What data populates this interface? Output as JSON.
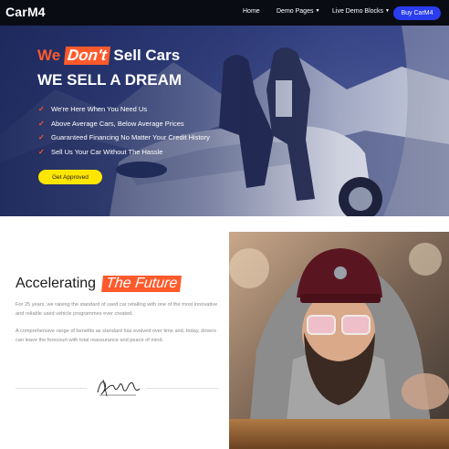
{
  "nav": {
    "logo": "CarM4",
    "links": [
      {
        "label": "Home"
      },
      {
        "label": "Demo Pages"
      },
      {
        "label": "Live Demo Blocks"
      }
    ],
    "cta": "Buy CarM4"
  },
  "hero": {
    "title_line1_prefix": "We",
    "title_line1_highlight": "Don't",
    "title_line1_suffix": "Sell Cars",
    "title_line2": "WE SELL A DREAM",
    "bullets": [
      "We're Here When You Need Us",
      "Above Average Cars, Below Average Prices",
      "Guaranteed Financing No Matter Your Credit History",
      "Sell Us Your Car Without The Hassle"
    ],
    "button": "Get Approved"
  },
  "about": {
    "title": "Accelerating",
    "title_highlight": "The Future",
    "paragraph1": "For 25 years, we raising the standard of used car retailing with one of the most innovative and reliable used vehicle programmes ever created.",
    "paragraph2": "A comprehensive range of benefits as standard has evolved over time and, today, drivers can leave the forecourt with total reassurance and peace of mind."
  },
  "colors": {
    "accent": "#ff5a2c",
    "nav_bg": "#0a0c14",
    "cta_blue": "#2a3cf0",
    "button_yellow": "#ffe600"
  },
  "icons": [
    "check-icon",
    "caret-down-icon",
    "signature-image"
  ]
}
